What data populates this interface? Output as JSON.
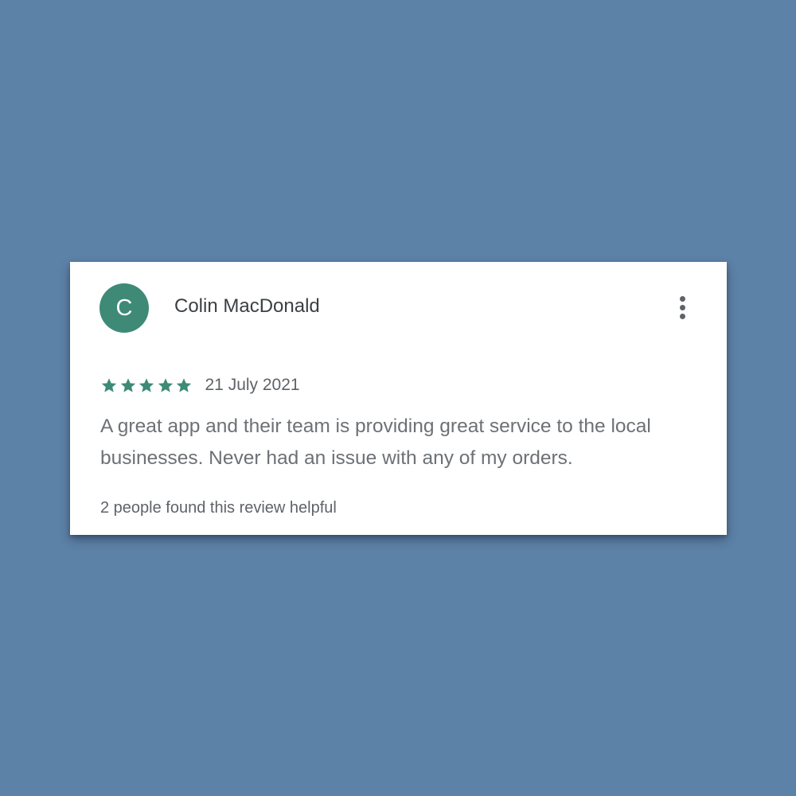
{
  "review": {
    "avatar_letter": "C",
    "avatar_color": "#3e8a76",
    "author": "Colin MacDonald",
    "menu_icon": "more-vert-icon",
    "rating": 5,
    "rating_max": 5,
    "star_color": "#3e8a76",
    "date": "21 July 2021",
    "text": "A great app and their team is providing great service to the local businesses. Never had an issue with any of my orders.",
    "helpful": "2 people found this review helpful"
  },
  "colors": {
    "background": "#5d82a7",
    "card": "#ffffff"
  }
}
